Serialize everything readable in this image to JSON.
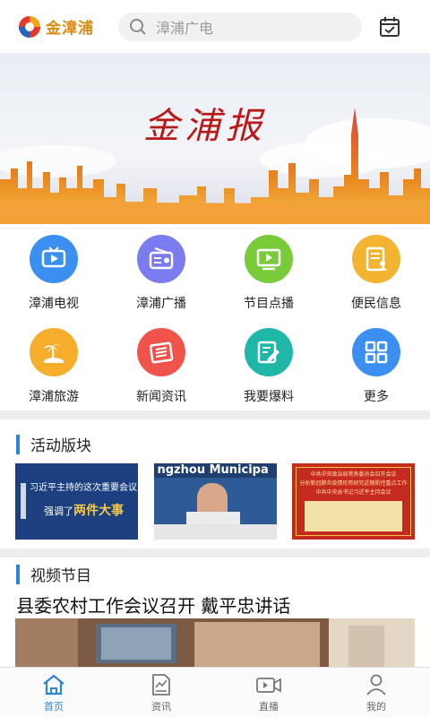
{
  "header": {
    "app_name": "金漳浦",
    "search_placeholder": "漳浦广电",
    "icons": {
      "logo": "app-logo",
      "search": "search-icon",
      "calendar": "calendar-check-icon"
    }
  },
  "banner": {
    "title": "金浦报"
  },
  "services": [
    {
      "label": "漳浦电视",
      "icon": "tv-icon",
      "color": "#3a8ff0"
    },
    {
      "label": "漳浦广播",
      "icon": "radio-icon",
      "color": "#7a7cf0"
    },
    {
      "label": "节目点播",
      "icon": "video-player-icon",
      "color": "#7acb3a"
    },
    {
      "label": "便民信息",
      "icon": "document-person-icon",
      "color": "#f3b431"
    },
    {
      "label": "漳浦旅游",
      "icon": "beach-palm-icon",
      "color": "#f6ad2b"
    },
    {
      "label": "新闻资讯",
      "icon": "newspaper-icon",
      "color": "#f0534a"
    },
    {
      "label": "我要爆料",
      "icon": "edit-note-icon",
      "color": "#1fb6a8"
    },
    {
      "label": "更多",
      "icon": "grid-more-icon",
      "color": "#3a8ff0"
    }
  ],
  "activities": {
    "title": "活动版块",
    "cards": [
      {
        "line1": "习近平主持的这次重要会议",
        "line2a": "强调了",
        "line2b": "两件大事"
      },
      {
        "caption": "ngzhou Municipa"
      },
      {
        "head1": "中共中央政治局常务委员会召开会议",
        "head2": "分析新冠肺炎疫情形势研究近期防控重点工作",
        "head3": "中共中央总书记习近平主持会议"
      }
    ]
  },
  "video": {
    "title": "视频节目",
    "headline": "县委农村工作会议召开 戴平忠讲话"
  },
  "tabbar": {
    "items": [
      {
        "label": "首页",
        "icon": "home-icon",
        "active": true
      },
      {
        "label": "资讯",
        "icon": "news-doc-icon",
        "active": false
      },
      {
        "label": "直播",
        "icon": "live-camera-icon",
        "active": false
      },
      {
        "label": "我的",
        "icon": "user-icon",
        "active": false
      }
    ]
  },
  "colors": {
    "accent": "#2b87d6",
    "brand": "#d88a10"
  }
}
